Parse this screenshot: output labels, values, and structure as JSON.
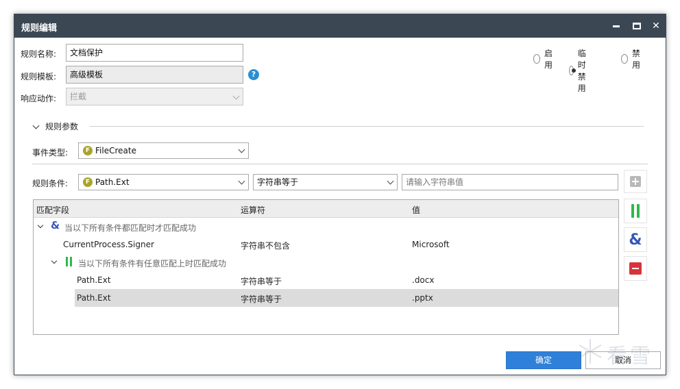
{
  "window": {
    "title": "规则编辑"
  },
  "form": {
    "rule_name_label": "规则名称:",
    "rule_name_value": "文档保护",
    "rule_template_label": "规则模板:",
    "rule_template_value": "高级模板",
    "response_action_label": "响应动作:",
    "response_action_value": "拦截"
  },
  "status_options": [
    {
      "label": "启用",
      "selected": false
    },
    {
      "label": "临时禁用",
      "selected": true
    },
    {
      "label": "禁用",
      "selected": false
    }
  ],
  "section": {
    "title": "规则参数"
  },
  "event": {
    "label": "事件类型:",
    "badge": "F",
    "value": "FileCreate"
  },
  "condition": {
    "label": "规则条件:",
    "badge": "F",
    "field_value": "Path.Ext",
    "operator_value": "字符串等于",
    "input_placeholder": "请输入字符串值"
  },
  "table": {
    "headers": [
      "匹配字段",
      "运算符",
      "值"
    ],
    "group_all_text": "当以下所有条件都匹配时才匹配成功",
    "group_any_text": "当以下所有条件有任意匹配上时匹配成功",
    "rows": [
      {
        "field": "CurrentProcess.Signer",
        "op": "字符串不包含",
        "value": "Microsoft"
      },
      {
        "field": "Path.Ext",
        "op": "字符串等于",
        "value": ".docx"
      },
      {
        "field": "Path.Ext",
        "op": "字符串等于",
        "value": ".pptx"
      }
    ]
  },
  "side_icons": [
    "plus-icon",
    "or-icon",
    "and-icon",
    "minus-icon"
  ],
  "buttons": {
    "ok": "确定",
    "cancel": "取消"
  },
  "watermark": {
    "text": "看雪"
  },
  "colors": {
    "titlebar": "#3b4753",
    "primary": "#2f80d8",
    "or_green": "#2fb84a",
    "and_blue": "#3657b8",
    "remove_red": "#d8333a"
  }
}
